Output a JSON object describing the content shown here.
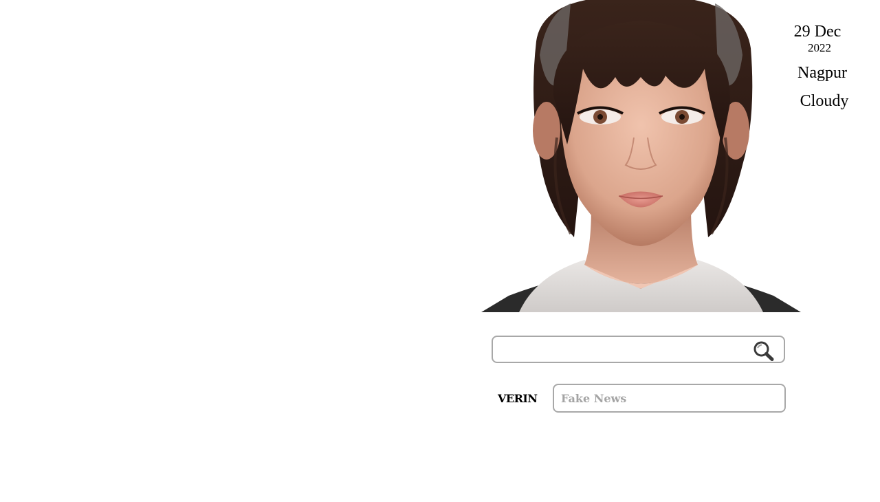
{
  "info": {
    "date_day": "29 Dec",
    "date_year": "2022",
    "city": "Nagpur",
    "weather": "Cloudy"
  },
  "search": {
    "value": "",
    "placeholder": "",
    "icon": "magnifier-icon"
  },
  "verin": {
    "label": "VERIN",
    "result_placeholder": "Fake News"
  },
  "avatar": {
    "icon": "avatar-portrait"
  }
}
